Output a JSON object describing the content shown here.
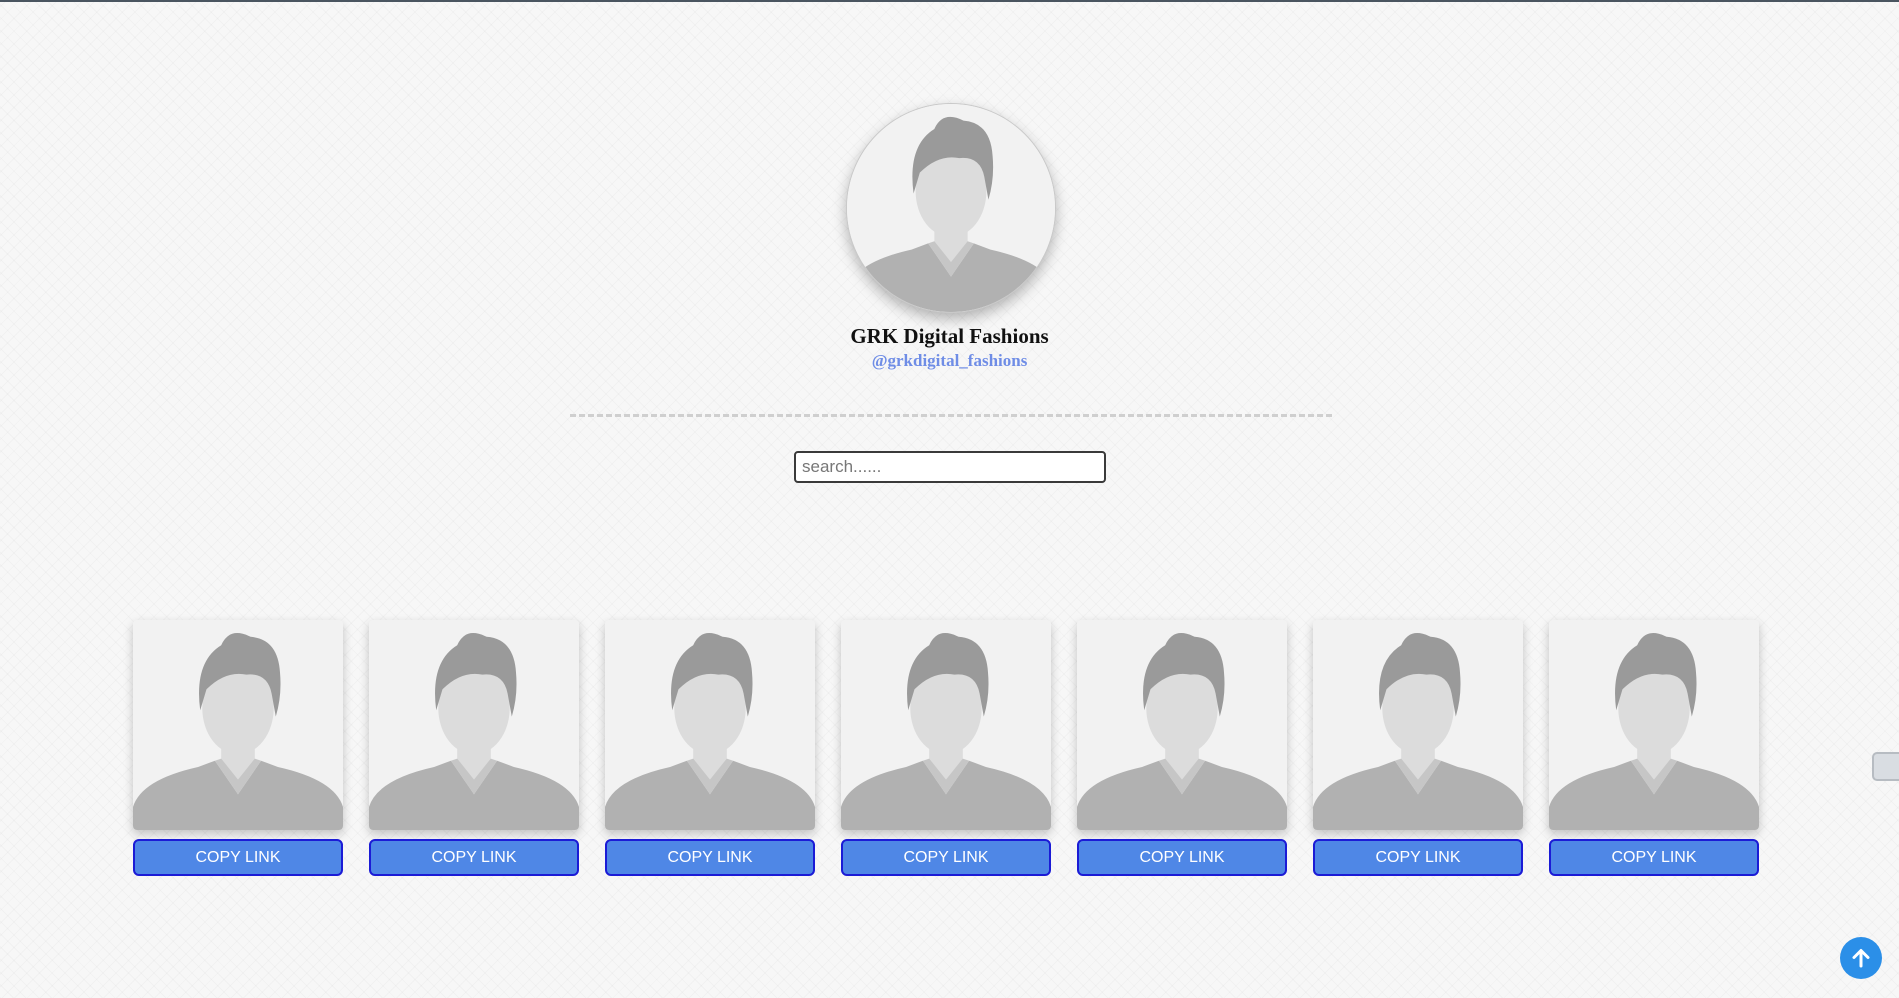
{
  "profile": {
    "name": "GRK Digital Fashions",
    "handle": "@grkdigital_fashions",
    "avatar_icon": "default-user-avatar"
  },
  "search": {
    "placeholder": "search......",
    "value": ""
  },
  "products": [
    {
      "icon": "default-user-avatar",
      "button_label": "COPY LINK"
    },
    {
      "icon": "default-user-avatar",
      "button_label": "COPY LINK"
    },
    {
      "icon": "default-user-avatar",
      "button_label": "COPY LINK"
    },
    {
      "icon": "default-user-avatar",
      "button_label": "COPY LINK"
    },
    {
      "icon": "default-user-avatar",
      "button_label": "COPY LINK"
    },
    {
      "icon": "default-user-avatar",
      "button_label": "COPY LINK"
    },
    {
      "icon": "default-user-avatar",
      "button_label": "COPY LINK"
    }
  ],
  "floating": {
    "side_tab_icon": "side-widget-tab-icon",
    "scroll_top_icon": "arrow-up-icon"
  },
  "colors": {
    "button_bg": "#4f87e6",
    "button_border": "#1b1bd6",
    "handle_text": "#6f8de6",
    "scroll_top_bg": "#2b8fe8"
  }
}
